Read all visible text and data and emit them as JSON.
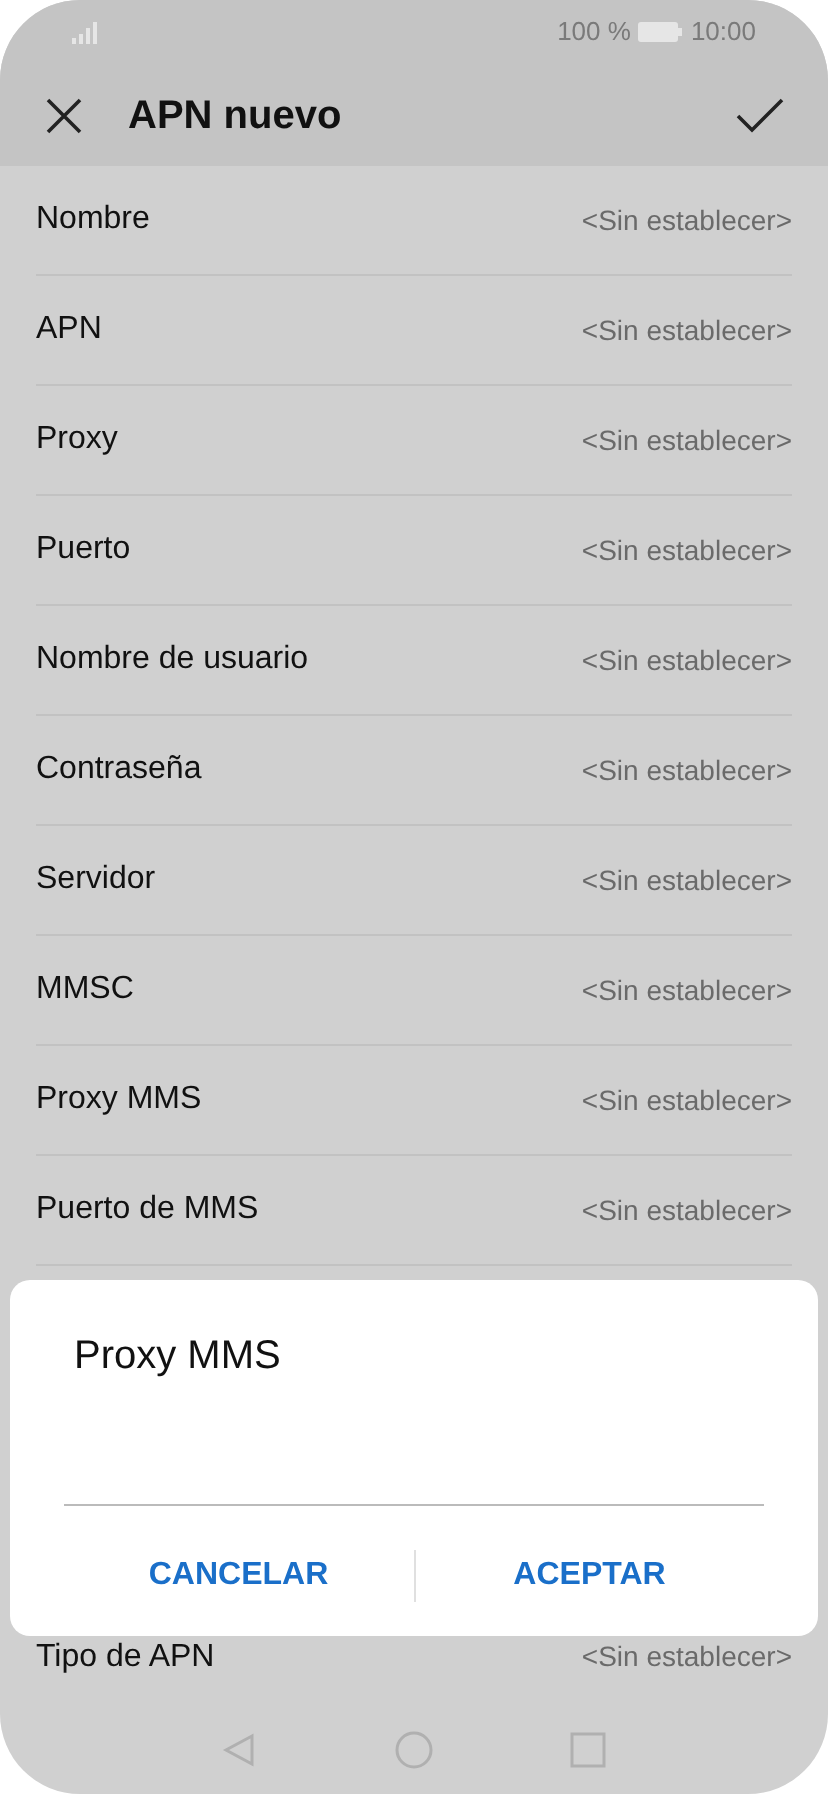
{
  "status_bar": {
    "battery": "100 %",
    "time": "10:00"
  },
  "header": {
    "title": "APN nuevo"
  },
  "settings": [
    {
      "label": "Nombre",
      "value": "<Sin establecer>"
    },
    {
      "label": "APN",
      "value": "<Sin establecer>"
    },
    {
      "label": "Proxy",
      "value": "<Sin establecer>"
    },
    {
      "label": "Puerto",
      "value": "<Sin establecer>"
    },
    {
      "label": "Nombre de usuario",
      "value": "<Sin establecer>"
    },
    {
      "label": "Contraseña",
      "value": "<Sin establecer>"
    },
    {
      "label": "Servidor",
      "value": "<Sin establecer>"
    },
    {
      "label": "MMSC",
      "value": "<Sin establecer>"
    },
    {
      "label": "Proxy MMS",
      "value": "<Sin establecer>"
    },
    {
      "label": "Puerto de MMS",
      "value": "<Sin establecer>"
    },
    {
      "label": "Tipo de APN",
      "value": "<Sin establecer>"
    }
  ],
  "dialog": {
    "title": "Proxy MMS",
    "buttons": [
      "CANCELAR",
      "ACEPTAR"
    ]
  }
}
